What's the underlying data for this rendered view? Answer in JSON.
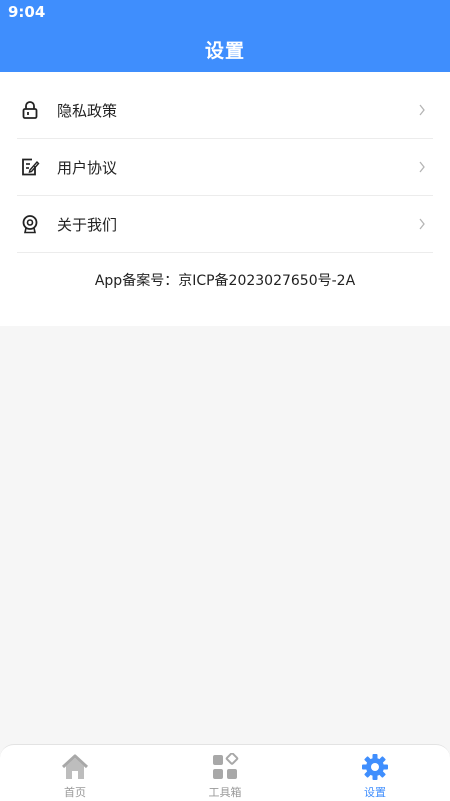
{
  "status_bar": {
    "time": "9:04"
  },
  "header": {
    "title": "设置"
  },
  "menu": {
    "items": [
      {
        "label": "隐私政策",
        "icon": "lock-icon"
      },
      {
        "label": "用户协议",
        "icon": "edit-document-icon"
      },
      {
        "label": "关于我们",
        "icon": "badge-icon"
      }
    ]
  },
  "icp_text": "App备案号：京ICP备2023027650号-2A",
  "tabbar": {
    "items": [
      {
        "label": "首页",
        "icon": "home-icon",
        "active": false
      },
      {
        "label": "工具箱",
        "icon": "toolbox-grid-icon",
        "active": false
      },
      {
        "label": "设置",
        "icon": "gear-icon",
        "active": true
      }
    ]
  },
  "colors": {
    "primary": "#3f8efd",
    "inactive": "#9a9a9a",
    "background": "#f6f6f6"
  }
}
